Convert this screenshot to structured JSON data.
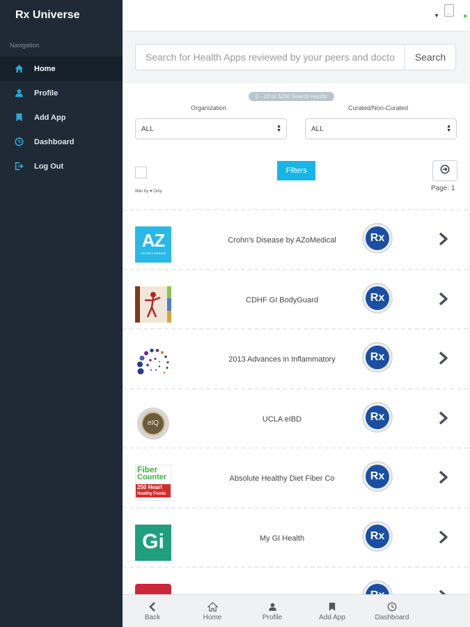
{
  "app": {
    "brand": "Rx Universe"
  },
  "sidebar": {
    "section_label": "Navigation",
    "items": [
      {
        "label": "Home",
        "icon": "home-icon",
        "active": true
      },
      {
        "label": "Profile",
        "icon": "user-icon",
        "active": false
      },
      {
        "label": "Add App",
        "icon": "bookmark-icon",
        "active": false
      },
      {
        "label": "Dashboard",
        "icon": "clock-icon",
        "active": false
      },
      {
        "label": "Log Out",
        "icon": "logout-icon",
        "active": false
      }
    ]
  },
  "topbar": {
    "status_color": "#2ecc40"
  },
  "search": {
    "placeholder": "Search for Health Apps reviewed by your peers and doctors",
    "button_label": "Search"
  },
  "filters": {
    "results_text": "0 - 10 of 3266 Search results",
    "organization_label": "Organization",
    "organization_value": "ALL",
    "curated_label": "Curated/Non-Curated",
    "curated_value": "ALL",
    "favorites_label": "filter by ♥ Only",
    "filters_button": "Filters",
    "page_label": "Page: 1"
  },
  "apps": [
    {
      "name": "Crohn's Disease by AZoMedical",
      "icon": "azomedical-logo",
      "badge": "Rx"
    },
    {
      "name": "CDHF GI BodyGuard",
      "icon": "cdhf-bodyguard-logo",
      "badge": "Rx"
    },
    {
      "name": "2013 Advances in Inflammatory",
      "icon": "dots-circle-logo",
      "badge": "Rx"
    },
    {
      "name": "UCLA eIBD",
      "icon": "ucla-eibd-logo",
      "badge": "Rx"
    },
    {
      "name": "Absolute Healthy Diet Fiber Co",
      "icon": "fiber-counter-logo",
      "badge": "Rx"
    },
    {
      "name": "My GI Health",
      "icon": "gi-logo",
      "badge": "Rx"
    },
    {
      "name": "",
      "icon": "partial-red-logo",
      "badge": "Rx"
    }
  ],
  "app_icon_text": {
    "az": "AZ",
    "az_sub": "CROHN'S DISEASE",
    "fiber1": "Fiber",
    "fiber2": "Counter",
    "fiber3": "250 Heart",
    "fiber4": "Healthy Foods",
    "gi": "Gi",
    "ucla": "eIQ"
  },
  "tabbar": [
    {
      "label": "Back",
      "icon": "chevron-left-icon"
    },
    {
      "label": "Home",
      "icon": "home-icon"
    },
    {
      "label": "Profile",
      "icon": "user-icon"
    },
    {
      "label": "Add App",
      "icon": "bookmark-icon"
    },
    {
      "label": "Dashboard",
      "icon": "clock-icon"
    }
  ],
  "colors": {
    "sidebar_bg": "#1f2a36",
    "accent": "#18b6e6",
    "rx_badge": "#1a4fa3"
  }
}
